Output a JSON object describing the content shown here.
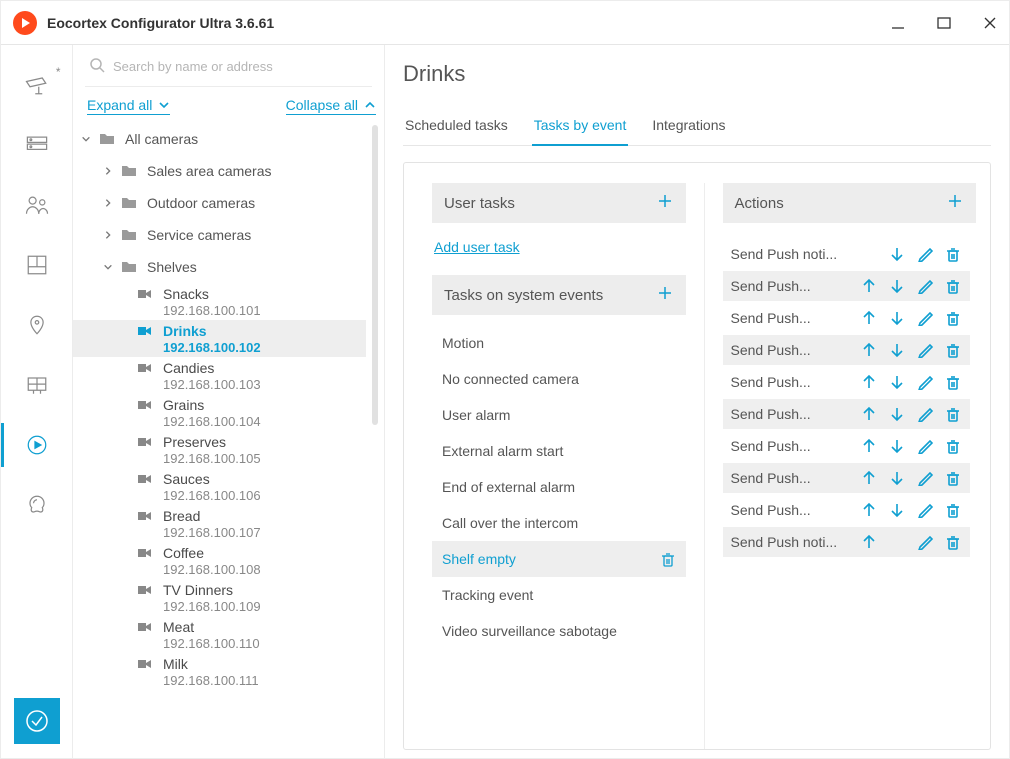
{
  "window": {
    "title": "Eocortex Configurator Ultra 3.6.61"
  },
  "sidebar": {
    "search_placeholder": "Search by name or address",
    "expand_label": "Expand all",
    "collapse_label": "Collapse all",
    "groups": [
      {
        "name": "All cameras"
      },
      {
        "name": "Sales area cameras"
      },
      {
        "name": "Outdoor cameras"
      },
      {
        "name": "Service cameras"
      },
      {
        "name": "Shelves"
      }
    ],
    "cameras": [
      {
        "name": "Snacks",
        "ip": "192.168.100.101"
      },
      {
        "name": "Drinks",
        "ip": "192.168.100.102"
      },
      {
        "name": "Candies",
        "ip": "192.168.100.103"
      },
      {
        "name": "Grains",
        "ip": "192.168.100.104"
      },
      {
        "name": "Preserves",
        "ip": "192.168.100.105"
      },
      {
        "name": "Sauces",
        "ip": "192.168.100.106"
      },
      {
        "name": "Bread",
        "ip": "192.168.100.107"
      },
      {
        "name": "Coffee",
        "ip": "192.168.100.108"
      },
      {
        "name": "TV Dinners",
        "ip": "192.168.100.109"
      },
      {
        "name": "Meat",
        "ip": "192.168.100.110"
      },
      {
        "name": "Milk",
        "ip": "192.168.100.111"
      }
    ],
    "selected_camera": "Drinks"
  },
  "page": {
    "title": "Drinks"
  },
  "tabs": [
    {
      "label": "Scheduled tasks"
    },
    {
      "label": "Tasks by event",
      "active": true
    },
    {
      "label": "Integrations"
    }
  ],
  "user_tasks": {
    "header": "User tasks",
    "add_label": "Add user task"
  },
  "system_tasks": {
    "header": "Tasks on system events",
    "events": [
      "Motion",
      "No connected camera",
      "User alarm",
      "External alarm start",
      "End of external alarm",
      "Call over the intercom",
      "Shelf empty",
      "Tracking event",
      "Video surveillance sabotage"
    ],
    "selected_event": "Shelf empty"
  },
  "actions": {
    "header": "Actions",
    "items": [
      {
        "name": "Send Push noti...",
        "up": false,
        "down": true
      },
      {
        "name": "Send Push...",
        "up": true,
        "down": true
      },
      {
        "name": "Send Push...",
        "up": true,
        "down": true
      },
      {
        "name": "Send Push...",
        "up": true,
        "down": true
      },
      {
        "name": "Send Push...",
        "up": true,
        "down": true
      },
      {
        "name": "Send Push...",
        "up": true,
        "down": true
      },
      {
        "name": "Send Push...",
        "up": true,
        "down": true
      },
      {
        "name": "Send Push...",
        "up": true,
        "down": true
      },
      {
        "name": "Send Push...",
        "up": true,
        "down": true
      },
      {
        "name": "Send Push noti...",
        "up": true,
        "down": false
      }
    ]
  }
}
